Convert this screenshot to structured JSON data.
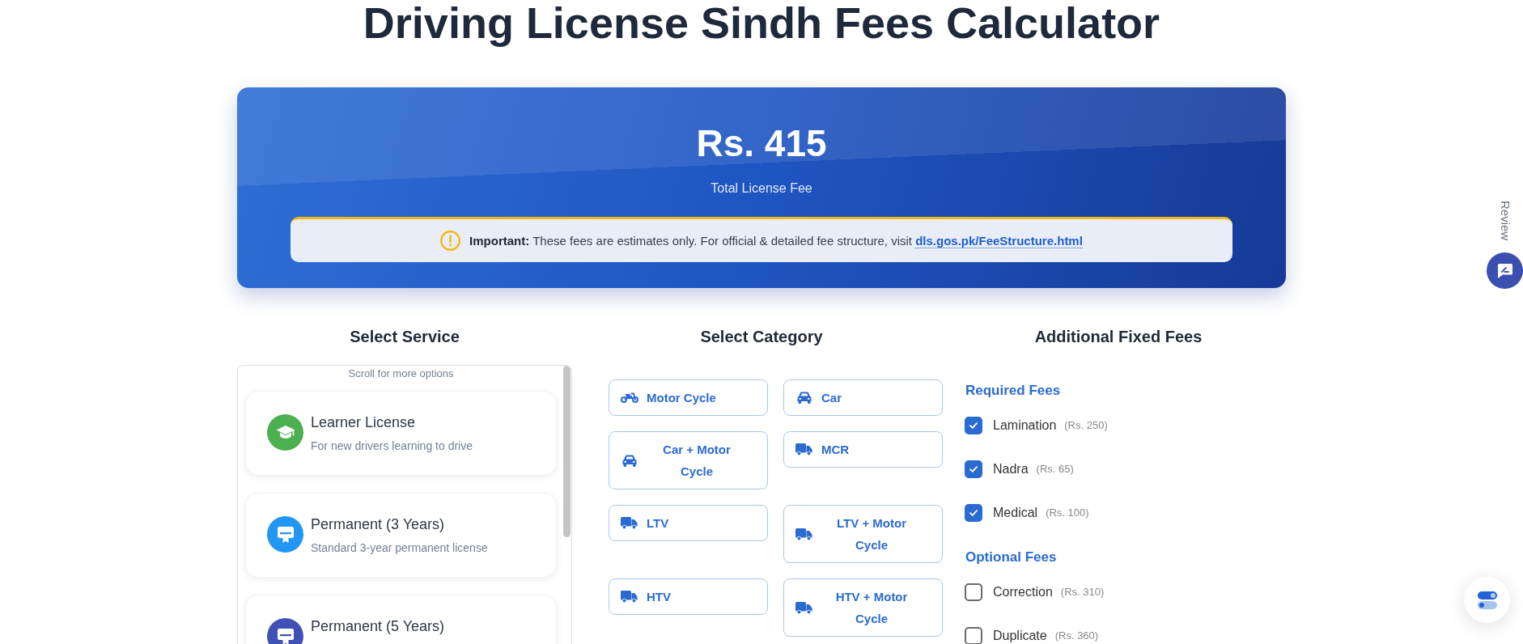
{
  "title": "Driving License Sindh Fees Calculator",
  "total": {
    "amount": "Rs. 415",
    "label": "Total License Fee",
    "notice": {
      "text": "**Important:** These fees are estimates only. For official & detailed fee structure, visit",
      "link": "dls.gos.pk/FeeStructure.html"
    }
  },
  "service": {
    "heading": "Select Service",
    "hint": "Scroll for more options",
    "items": [
      {
        "kind": "learner",
        "color": "#4caf50",
        "title": "Learner License",
        "description": "For new drivers learning to drive",
        "selected": false
      },
      {
        "kind": "permanent",
        "color": "#2196f3",
        "title": "Permanent (3 Years)",
        "description": "Standard 3-year permanent license",
        "selected": false
      },
      {
        "kind": "permanent",
        "color": "#3f51b5",
        "title": "Permanent (5 Years)",
        "selected": false
      }
    ]
  },
  "category": {
    "heading": "Select Category",
    "items": [
      {
        "kind": "motorcycle",
        "label": "Motor Cycle",
        "selected": false
      },
      {
        "kind": "car",
        "label": "Car",
        "selected": false
      },
      {
        "kind": "car",
        "label": "Car + Motor Cycle",
        "selected": false
      },
      {
        "kind": "truck",
        "label": "MCR",
        "selected": false
      },
      {
        "kind": "truck",
        "label": "LTV",
        "selected": false
      },
      {
        "kind": "truck",
        "label": "LTV + Motor Cycle",
        "selected": false
      },
      {
        "kind": "truck",
        "label": "HTV",
        "selected": false
      },
      {
        "kind": "truck",
        "label": "HTV + Motor Cycle",
        "selected": false
      }
    ]
  },
  "fees": {
    "heading": "Additional Fixed Fees",
    "groups": [
      {
        "title": "Required Fees",
        "items": [
          {
            "label": "Lamination",
            "price": "(Rs. 250)",
            "checked": true
          },
          {
            "label": "Nadra",
            "price": "(Rs. 65)",
            "checked": true
          },
          {
            "label": "Medical",
            "price": "(Rs. 100)",
            "checked": true
          }
        ]
      },
      {
        "title": "Optional Fees",
        "items": [
          {
            "label": "Correction",
            "price": "(Rs. 310)",
            "checked": false
          },
          {
            "label": "Duplicate",
            "price": "(Rs. 360)",
            "checked": false
          }
        ]
      }
    ]
  },
  "review": {
    "label": "Review"
  }
}
